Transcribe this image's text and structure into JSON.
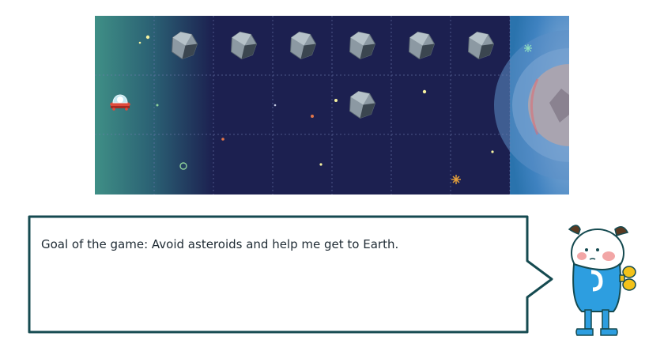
{
  "board": {
    "columns": 7,
    "rows": 3,
    "colors": {
      "space": "#1c2050",
      "launch_zone": "#3f8f86",
      "earth_zone": "#2a73ad",
      "asteroid": "#8c99a3",
      "ship_hull": "#e04a3c"
    },
    "asteroids": [
      {
        "col": 2,
        "row": 1
      },
      {
        "col": 3,
        "row": 1
      },
      {
        "col": 4,
        "row": 1
      },
      {
        "col": 5,
        "row": 1
      },
      {
        "col": 6,
        "row": 1
      },
      {
        "col": 7,
        "row": 1
      },
      {
        "col": 5,
        "row": 2
      }
    ],
    "ship": {
      "col": 1,
      "row": 2
    },
    "goal": "earth"
  },
  "dialog": {
    "text": "Goal of the game: Avoid asteroids and help me get to Earth."
  },
  "mascot": {
    "icon": "robot-mascot-icon",
    "colors": {
      "body": "#2d9ee0",
      "key": "#f3c21a"
    }
  }
}
